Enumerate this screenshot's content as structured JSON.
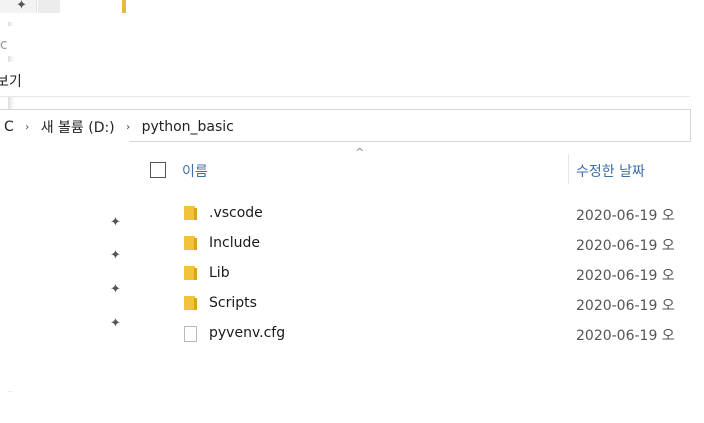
{
  "window": {
    "title_fragment": "ic",
    "ribbon_fragment": "보기"
  },
  "address": {
    "crumbs": [
      "C",
      "새 볼륨 (D:)",
      "python_basic"
    ],
    "separator": "›"
  },
  "columns": {
    "name": "이름",
    "date_modified": "수정한 날짜",
    "sort_caret": "^"
  },
  "files": [
    {
      "name": ".vscode",
      "type": "folder",
      "date": "2020-06-19 오"
    },
    {
      "name": "Include",
      "type": "folder",
      "date": "2020-06-19 오"
    },
    {
      "name": "Lib",
      "type": "folder",
      "date": "2020-06-19 오"
    },
    {
      "name": "Scripts",
      "type": "folder",
      "date": "2020-06-19 오"
    },
    {
      "name": "pyvenv.cfg",
      "type": "file",
      "date": "2020-06-19 오"
    }
  ],
  "icons": {
    "pin": "📌",
    "folder": "folder-icon",
    "file": "file-icon"
  },
  "colors": {
    "folder": "#f2c23a",
    "header_text": "#3d6ea8"
  }
}
